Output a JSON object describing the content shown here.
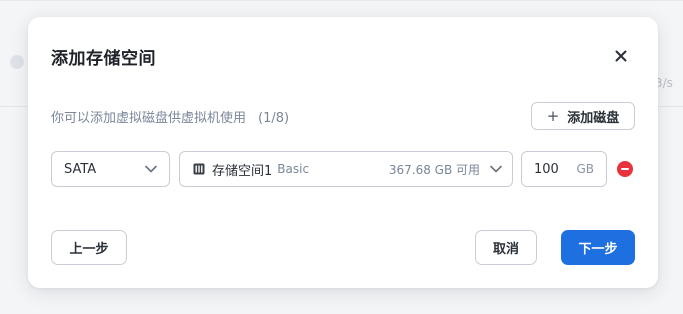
{
  "background": {
    "rate_fragment": "3/s"
  },
  "dialog": {
    "title": "添加存储空间",
    "close_icon": "close-icon",
    "subtitle": "你可以添加虚拟磁盘供虚拟机使用",
    "disk_count": "(1/8)",
    "add_disk_label": "添加磁盘",
    "add_disk_icon": "plus-icon",
    "disk_row": {
      "bus_type": "SATA",
      "storage_pool_name": "存储空间1",
      "storage_pool_tag": "Basic",
      "storage_pool_free": "367.68 GB 可用",
      "storage_pool_icon": "storage-pool-icon",
      "size_value": "100",
      "size_unit": "GB",
      "remove_icon": "remove-icon"
    },
    "buttons": {
      "prev": "上一步",
      "cancel": "取消",
      "next": "下一步"
    }
  },
  "colors": {
    "accent": "#1e6fe0",
    "danger": "#e8323c",
    "muted_text": "#7a8799",
    "border": "#c9ced6"
  }
}
